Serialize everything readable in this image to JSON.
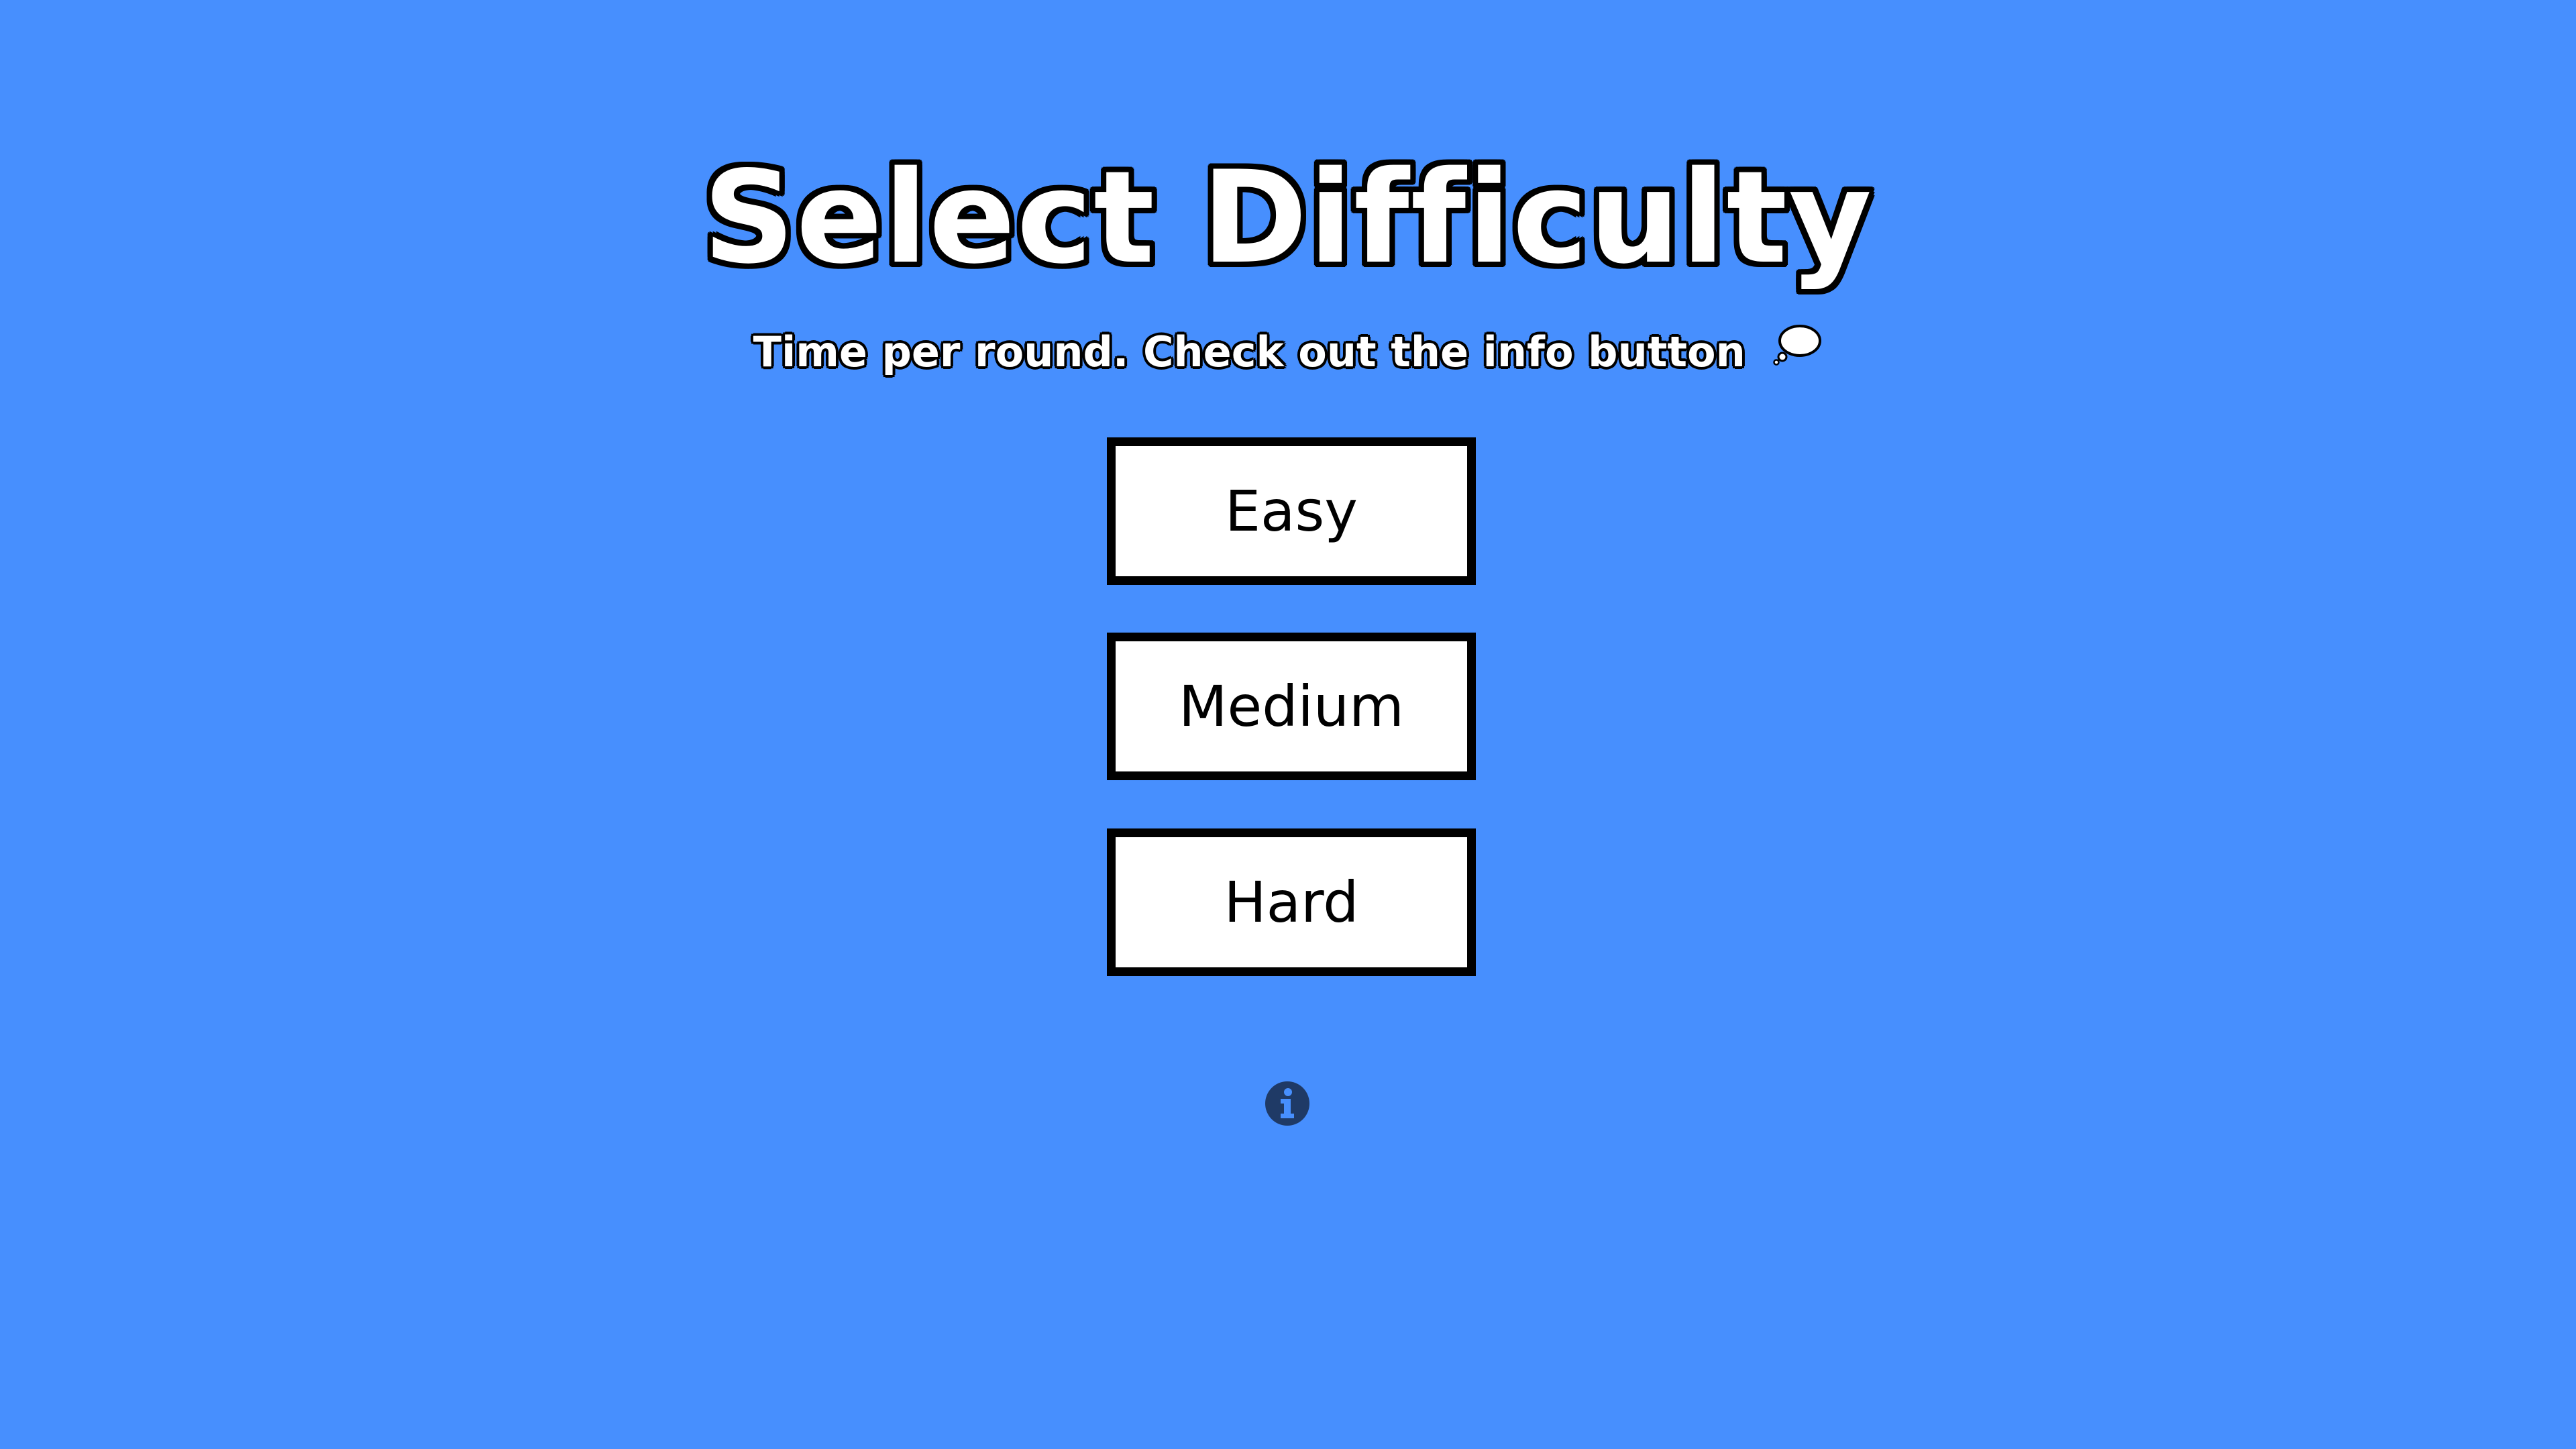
{
  "screen": {
    "title": "Select Difficulty",
    "subtitle": "Time per round. Check out the info button",
    "subtitle_icon": "thought-bubble-icon"
  },
  "buttons": {
    "easy": "Easy",
    "medium": "Medium",
    "hard": "Hard"
  },
  "info_button": {
    "icon": "info-circle-icon"
  },
  "colors": {
    "background": "#478ffe",
    "button_fill": "#ffffff",
    "button_border": "#000000",
    "info_icon": "#1f3a66"
  }
}
